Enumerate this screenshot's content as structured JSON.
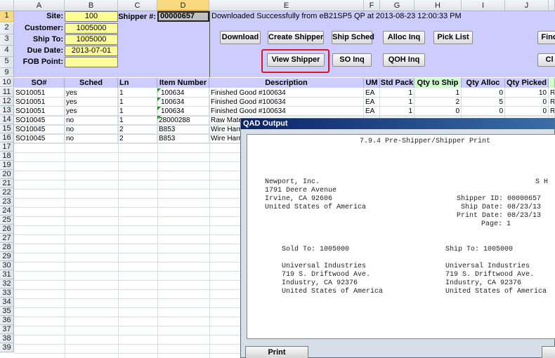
{
  "columns": [
    "A",
    "B",
    "C",
    "D",
    "E",
    "F",
    "G",
    "H",
    "I",
    "J"
  ],
  "rows": [
    "1",
    "2",
    "3",
    "4",
    "5",
    "9",
    "10",
    "11",
    "12",
    "13",
    "14",
    "15",
    "16",
    "17",
    "18",
    "19",
    "20",
    "21",
    "22",
    "23",
    "24",
    "25",
    "26",
    "27",
    "28",
    "29",
    "30",
    "31",
    "32",
    "33",
    "34",
    "35",
    "36",
    "37",
    "38",
    "39"
  ],
  "header_panel": {
    "site_label": "Site:",
    "site_value": "100",
    "customer_label": "Customer:",
    "customer_value": "1005000",
    "shipto_label": "Ship To:",
    "shipto_value": "1005000",
    "duedate_label": "Due Date:",
    "duedate_value": "2013-07-01",
    "fob_label": "FOB Point:",
    "fob_value": "",
    "shipper_label": "Shipper #:",
    "shipper_value": "00000657",
    "status": "Downloaded Successfully from eB21SP5 QP at 2013-08-23 12:00:33 PM"
  },
  "buttons": {
    "download": "Download",
    "create_shipper": "Create Shipper",
    "ship_sched": "Ship Sched",
    "alloc_inq": "Alloc Inq",
    "pick_list": "Pick List",
    "find": "Find",
    "view_shipper": "View Shipper",
    "so_inq": "SO Inq",
    "qoh_inq": "QOH Inq",
    "cl": "Cl"
  },
  "table": {
    "headers": [
      "SO#",
      "Sched",
      "Ln",
      "Item Number",
      "Description",
      "UM",
      "Std Pack",
      "Qty to Ship",
      "Qty Alloc",
      "Qty Picked",
      ""
    ],
    "rows": [
      [
        "SO10051",
        "yes",
        "1",
        "100634",
        "Finished Good #100634",
        "EA",
        "1",
        "1",
        "0",
        "10",
        "R"
      ],
      [
        "SO10051",
        "yes",
        "1",
        "100634",
        "Finished Good #100634",
        "EA",
        "1",
        "2",
        "5",
        "0",
        "R"
      ],
      [
        "SO10051",
        "yes",
        "1",
        "100634",
        "Finished Good #100634",
        "EA",
        "1",
        "0",
        "0",
        "0",
        "R"
      ],
      [
        "SO10045",
        "no",
        "1",
        "28000288",
        "Raw Mate",
        "",
        "",
        "",
        "",
        "",
        ""
      ],
      [
        "SO10045",
        "no",
        "2",
        "B853",
        "Wire Harr",
        "",
        "",
        "",
        "",
        "",
        ""
      ],
      [
        "SO10045",
        "no",
        "2",
        "B853",
        "Wire Harr",
        "",
        "",
        "",
        "",
        "",
        ""
      ]
    ]
  },
  "qad": {
    "title": "QAD Output",
    "report_title": "7.9.4 Pre-Shipper/Shipper Print",
    "company": [
      "Newport, Inc.",
      "1791 Deere Avenue",
      "Irvine, CA 92606",
      "United States of America"
    ],
    "right_header": "S H",
    "shipper_info": [
      "Shipper ID: 00000657",
      "Ship Date: 08/23/13",
      "Print Date: 08/23/13",
      "Page: 1"
    ],
    "sold_to": "Sold To: 1005000",
    "ship_to": "Ship To: 1005000",
    "sold_addr": [
      "Universal Industries",
      "719 S. Driftwood Ave.",
      "Industry, CA 92376",
      "United States of America"
    ],
    "ship_addr": [
      "Universal Industries",
      "719 S. Driftwood Ave.",
      "Industry, CA 92376",
      "United States of America"
    ],
    "print_button": "Print"
  }
}
